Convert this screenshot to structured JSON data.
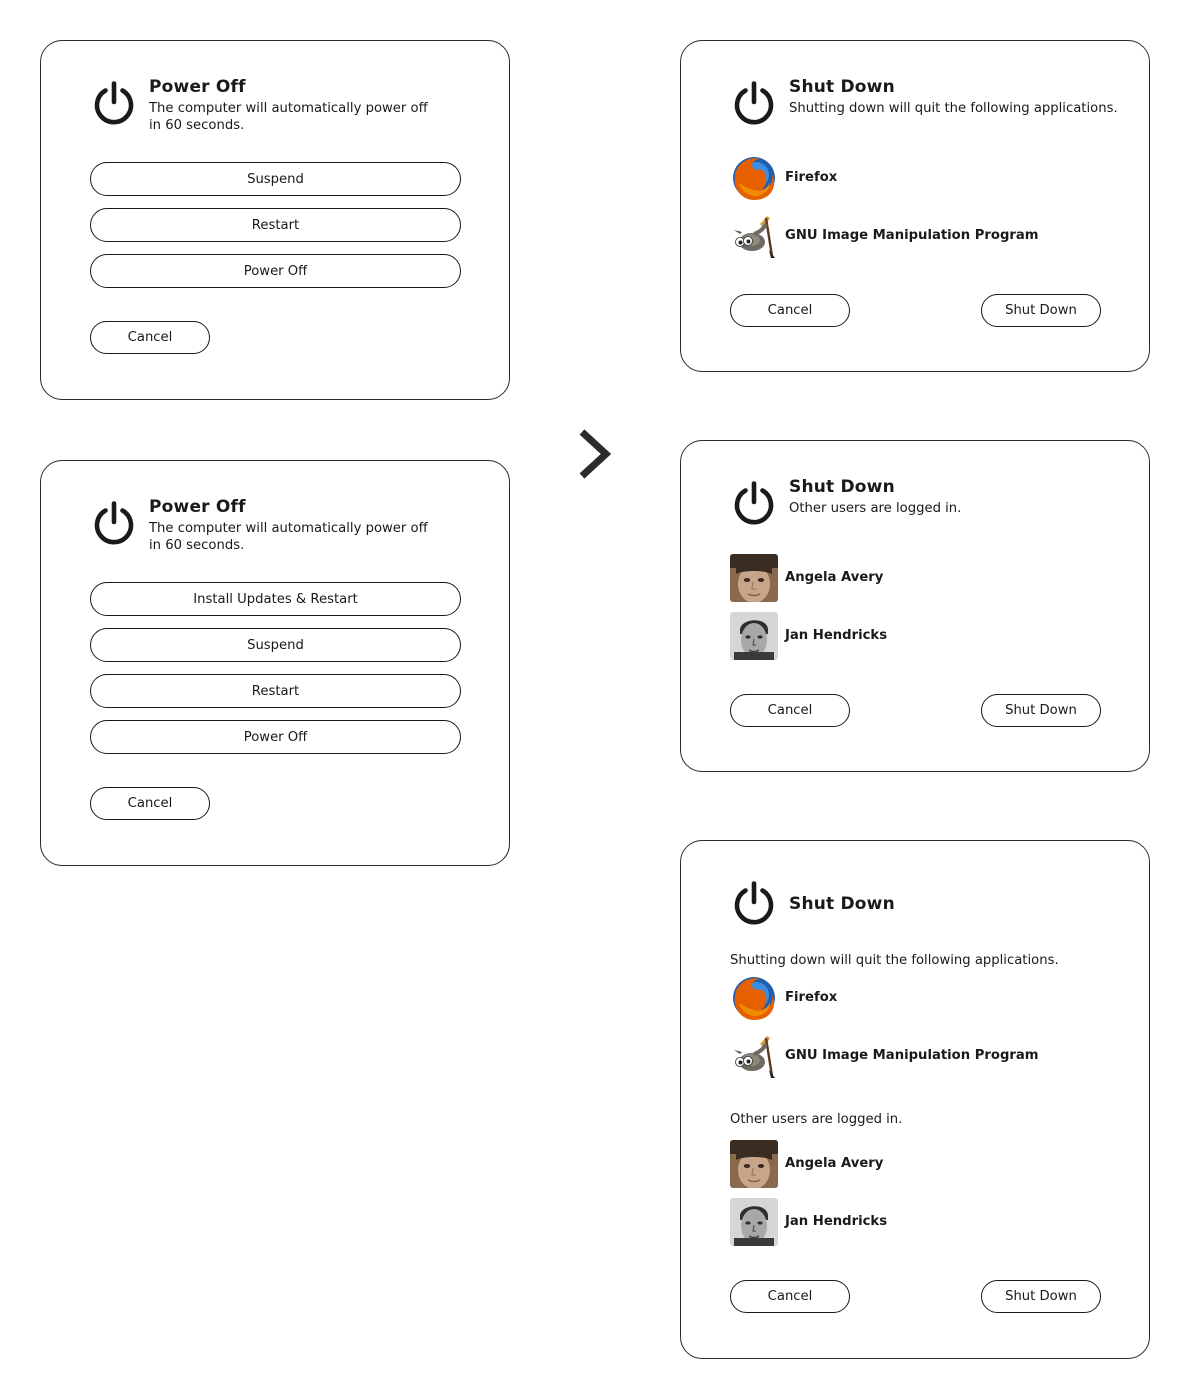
{
  "power_off_dialog": {
    "title": "Power Off",
    "description": "The computer will automatically power off in 60 seconds.",
    "buttons": [
      "Suspend",
      "Restart",
      "Power Off"
    ],
    "cancel_label": "Cancel"
  },
  "power_off_updates_dialog": {
    "title": "Power Off",
    "description": "The computer will automatically power off in 60 seconds.",
    "buttons": [
      "Install Updates & Restart",
      "Suspend",
      "Restart",
      "Power Off"
    ],
    "cancel_label": "Cancel"
  },
  "shutdown_apps_dialog": {
    "title": "Shut Down",
    "description": "Shutting down will quit the following applications.",
    "apps": [
      {
        "name": "Firefox",
        "icon": "firefox-icon"
      },
      {
        "name": "GNU Image Manipulation Program",
        "icon": "gimp-icon"
      }
    ],
    "cancel_label": "Cancel",
    "confirm_label": "Shut Down"
  },
  "shutdown_users_dialog": {
    "title": "Shut Down",
    "description": "Other users are logged in.",
    "users": [
      {
        "name": "Angela Avery",
        "icon": "avatar-angela"
      },
      {
        "name": "Jan Hendricks",
        "icon": "avatar-jan"
      }
    ],
    "cancel_label": "Cancel",
    "confirm_label": "Shut Down"
  },
  "shutdown_combined_dialog": {
    "title": "Shut Down",
    "apps_description": "Shutting down will quit the following applications.",
    "apps": [
      {
        "name": "Firefox",
        "icon": "firefox-icon"
      },
      {
        "name": "GNU Image Manipulation Program",
        "icon": "gimp-icon"
      }
    ],
    "users_description": "Other users are logged in.",
    "users": [
      {
        "name": "Angela Avery",
        "icon": "avatar-angela"
      },
      {
        "name": "Jan Hendricks",
        "icon": "avatar-jan"
      }
    ],
    "cancel_label": "Cancel",
    "confirm_label": "Shut Down"
  },
  "colors": {
    "border": "#2b2b2b",
    "text": "#1a1a1a",
    "firefox_orange": "#e66000",
    "firefox_blue": "#1f5fb0"
  }
}
